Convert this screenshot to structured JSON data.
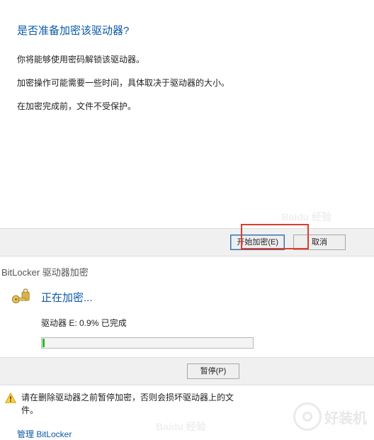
{
  "dialog": {
    "heading": "是否准备加密该驱动器?",
    "line1": "你将能够使用密码解锁该驱动器。",
    "line2": "加密操作可能需要一些时间，具体取决于驱动器的大小。",
    "line3": "在加密完成前，文件不受保护。",
    "start_label": "开始加密(E)",
    "cancel_label": "取消"
  },
  "progress": {
    "window_title": "BitLocker 驱动器加密",
    "title": "正在加密...",
    "status": "驱动器 E: 0.9% 已完成",
    "percent": 0.9,
    "pause_label": "暂停(P)"
  },
  "warning": {
    "text": "请在删除驱动器之前暂停加密，否则会损坏驱动器上的文件。",
    "manage_link": "管理 BitLocker"
  },
  "watermark": {
    "baidu": "Baidu 经验",
    "brand": "好装机"
  }
}
